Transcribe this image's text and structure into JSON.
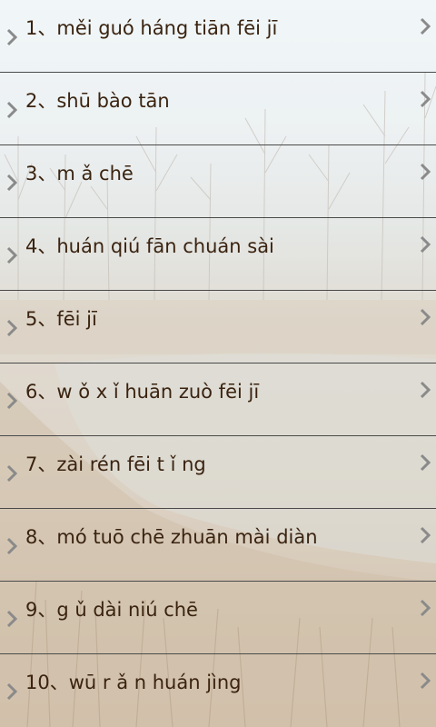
{
  "list": {
    "items": [
      {
        "label": "1、měi guó háng tiān fēi jī"
      },
      {
        "label": "2、shū bào tān"
      },
      {
        "label": "3、m ǎ chē"
      },
      {
        "label": "4、huán qiú fān chuán sài"
      },
      {
        "label": "5、fēi jī"
      },
      {
        "label": "6、w ǒ x ǐ  huān zuò fēi jī"
      },
      {
        "label": "7、zài rén fēi t ǐ ng"
      },
      {
        "label": "8、mó tuō chē zhuān mài diàn"
      },
      {
        "label": "9、g ǔ  dài niú chē"
      },
      {
        "label": "10、wū r ǎ n huán jìng"
      }
    ]
  },
  "icons": {
    "left": "chevron-right-icon",
    "right": "chevron-right-icon"
  },
  "colors": {
    "text": "#3a2310",
    "divider": "#4a4a4a",
    "chevron": "#8a8a8a"
  }
}
